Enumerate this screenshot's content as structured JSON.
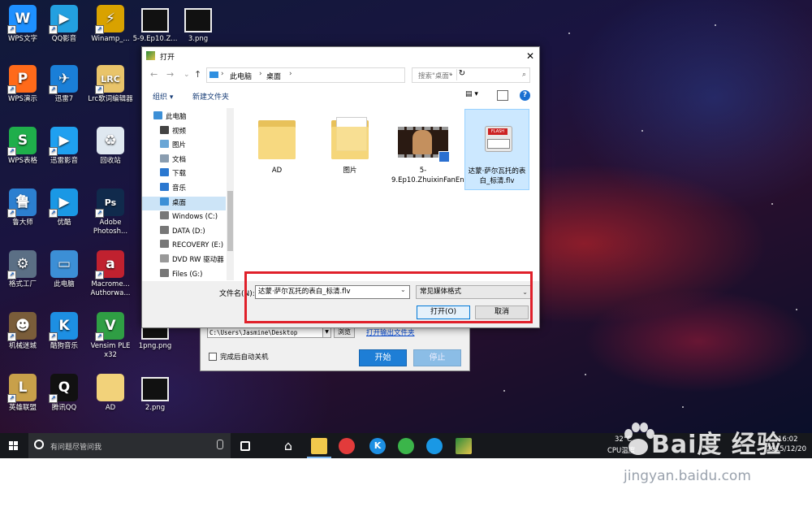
{
  "desktop": {
    "icons": [
      {
        "label": "WPS文字",
        "color": "#1e90ff",
        "glyph": "W"
      },
      {
        "label": "QQ影音",
        "color": "#23a0e0",
        "glyph": "▶"
      },
      {
        "label": "Winamp_...",
        "color": "#d9a200",
        "glyph": "⚡"
      },
      {
        "label": "5-9.Ep10.Z..."
      },
      {
        "label": "3.png"
      },
      {
        "label": "WPS演示",
        "color": "#ff6a1a",
        "glyph": "P"
      },
      {
        "label": "迅雷7",
        "color": "#1a7fd8",
        "glyph": "✈"
      },
      {
        "label": "Lrc歌词编辑器",
        "color": "#e9c46a",
        "glyph": "LRC"
      },
      {
        "label": "WPS表格",
        "color": "#1fae4b",
        "glyph": "S"
      },
      {
        "label": "迅雷影音",
        "color": "#1fa0f0",
        "glyph": "▶"
      },
      {
        "label": "回收站",
        "color": "#dfe8f0",
        "glyph": "♻"
      },
      {
        "label": "鲁大师",
        "color": "#2c7fd0",
        "glyph": "鲁"
      },
      {
        "label": "优酷",
        "color": "#1a98e5",
        "glyph": "▶"
      },
      {
        "label": "Adobe Photosh...",
        "color": "#102a4c",
        "glyph": "Ps"
      },
      {
        "label": "格式工厂",
        "color": "#5b6f85",
        "glyph": "⚙"
      },
      {
        "label": "此电脑",
        "color": "#3c8fd6",
        "glyph": "▭"
      },
      {
        "label": "Macrome... Authorwa...",
        "color": "#c0212f",
        "glyph": "a"
      },
      {
        "label": "机械迷城",
        "color": "#7a5d3a",
        "glyph": "☻"
      },
      {
        "label": "酷狗音乐",
        "color": "#1d8fe3",
        "glyph": "K"
      },
      {
        "label": "Vensim PLE x32",
        "color": "#2f9e44",
        "glyph": "V"
      },
      {
        "label": "1png.png"
      },
      {
        "label": "英雄联盟",
        "color": "#c8a04a",
        "glyph": "L"
      },
      {
        "label": "腾讯QQ",
        "color": "#111111",
        "glyph": "Q"
      },
      {
        "label": "AD",
        "color": "#f2d27a",
        "glyph": ""
      },
      {
        "label": "2.png"
      }
    ]
  },
  "back_window": {
    "path_value": "C:\\Users\\Jasmine\\Desktop",
    "browse_label": "浏览",
    "open_output_label": "打开输出文件夹",
    "auto_shutdown_label": "完成后自动关机",
    "start_label": "开始",
    "stop_label": "停止"
  },
  "dialog": {
    "title": "打开",
    "close_glyph": "✕",
    "breadcrumbs": [
      "此电脑",
      "桌面"
    ],
    "search_placeholder": "搜索\"桌面\"",
    "organize_label": "组织 ▾",
    "new_folder_label": "新建文件夹",
    "nav_items": [
      {
        "label": "此电脑",
        "icon": "computer-icon",
        "color": "#3c8fd6",
        "indent": 0
      },
      {
        "label": "视频",
        "icon": "video-icon",
        "color": "#444",
        "indent": 1
      },
      {
        "label": "图片",
        "icon": "picture-icon",
        "color": "#6aa6d6",
        "indent": 1
      },
      {
        "label": "文档",
        "icon": "document-icon",
        "color": "#8a9db0",
        "indent": 1
      },
      {
        "label": "下载",
        "icon": "download-icon",
        "color": "#2b78d0",
        "indent": 1
      },
      {
        "label": "音乐",
        "icon": "music-icon",
        "color": "#2b78d0",
        "indent": 1
      },
      {
        "label": "桌面",
        "icon": "desktop-icon",
        "color": "#3c8fd6",
        "indent": 1,
        "selected": true
      },
      {
        "label": "Windows (C:)",
        "icon": "drive-icon",
        "color": "#777",
        "indent": 1
      },
      {
        "label": "DATA (D:)",
        "icon": "drive-icon",
        "color": "#777",
        "indent": 1
      },
      {
        "label": "RECOVERY (E:)",
        "icon": "drive-icon",
        "color": "#777",
        "indent": 1
      },
      {
        "label": "DVD RW 驱动器",
        "icon": "dvd-icon",
        "color": "#999",
        "indent": 1
      },
      {
        "label": "Files (G:)",
        "icon": "drive-icon",
        "color": "#777",
        "indent": 1
      }
    ],
    "files": [
      {
        "label": "AD",
        "kind": "folder"
      },
      {
        "label": "图片",
        "kind": "folder-docs"
      },
      {
        "label": "5-9.Ep10.ZhuixinFanEnd.mp4",
        "kind": "video"
      },
      {
        "label": "达蒙·萨尔瓦托的表白_标清.flv",
        "kind": "flash",
        "selected": true
      }
    ],
    "file_name_label": "文件名(N):",
    "file_name_value": "达蒙·萨尔瓦托的表白_标清.flv",
    "file_type_value": "常见媒体格式",
    "open_label": "打开(O)",
    "cancel_label": "取消"
  },
  "taskbar": {
    "search_placeholder": "有问题尽管问我",
    "temperature": "32°C",
    "cpu_label": "CPU温度",
    "time": "16:02",
    "date": "2015/12/20"
  },
  "watermark": {
    "text": "Bai度 经验",
    "url": "jingyan.baidu.com"
  }
}
